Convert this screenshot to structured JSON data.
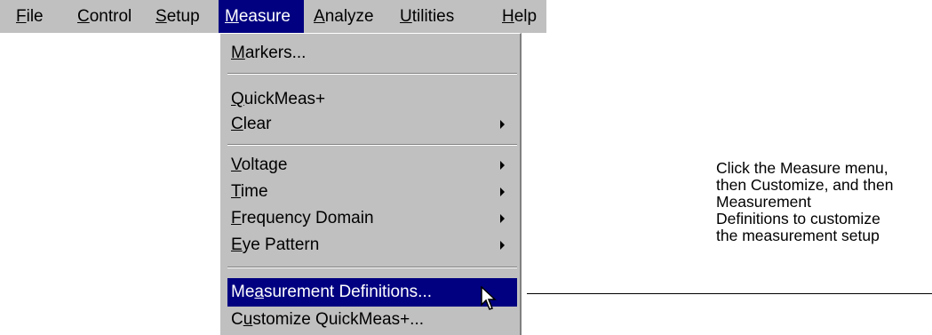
{
  "menubar": {
    "file": {
      "u": "F",
      "rest": "ile"
    },
    "control": {
      "u": "C",
      "rest": "ontrol"
    },
    "setup": {
      "u": "S",
      "rest": "etup"
    },
    "measure": {
      "u": "M",
      "rest": "easure"
    },
    "analyze": {
      "u": "A",
      "rest": "nalyze"
    },
    "utilities": {
      "u": "U",
      "rest": "tilities"
    },
    "help": {
      "u": "H",
      "rest": "elp"
    }
  },
  "measure_menu": {
    "markers": {
      "u": "M",
      "rest": "arkers..."
    },
    "quickmeas": {
      "u": "Q",
      "rest": "uickMeas+"
    },
    "clear": {
      "u": "C",
      "rest": "lear"
    },
    "voltage": {
      "u": "V",
      "rest": "oltage"
    },
    "time": {
      "u": "T",
      "rest": "ime"
    },
    "frequency": {
      "u": "F",
      "rest": "requency Domain"
    },
    "eye": {
      "u": "E",
      "rest": "ye Pattern"
    },
    "meas_defs": {
      "pre": "Me",
      "u": "a",
      "rest": "surement Definitions..."
    },
    "customize": {
      "pre": "C",
      "u": "u",
      "rest": "stomize QuickMeas+..."
    }
  },
  "callout": {
    "lines": [
      "Click the Measure menu,",
      "then Customize, and then",
      "Measurement",
      "Definitions to customize",
      "the measurement setup"
    ]
  }
}
